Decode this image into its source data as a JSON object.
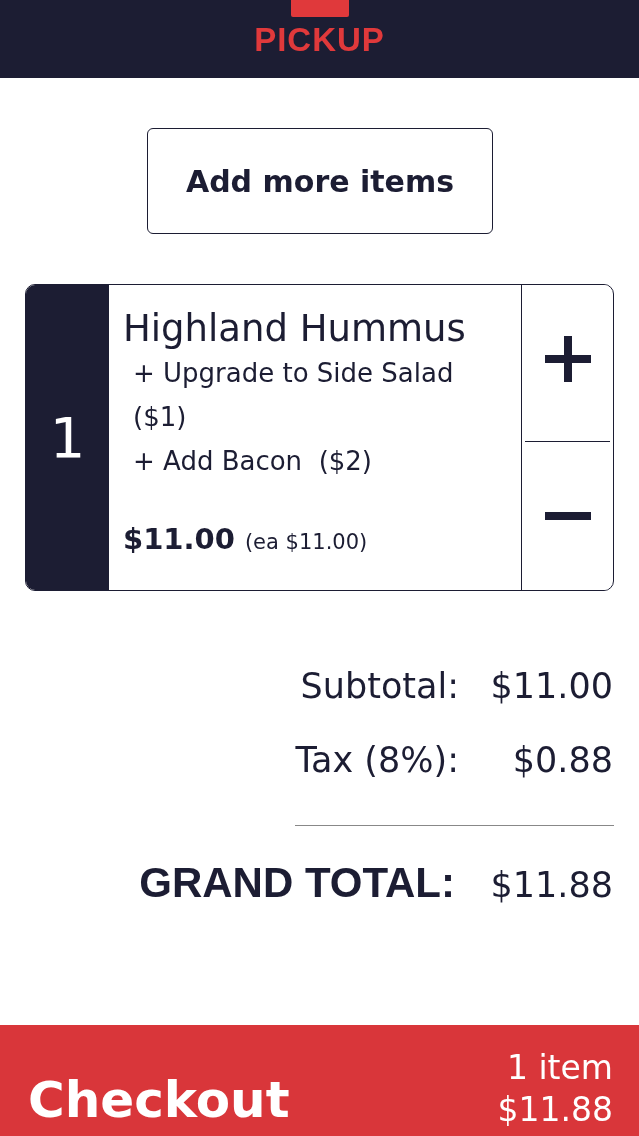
{
  "header": {
    "tab_label": "PICKUP"
  },
  "add_button": {
    "label": "Add more items"
  },
  "cart_items": [
    {
      "quantity": "1",
      "name": "Highland Hummus",
      "modifiers": [
        "+ Upgrade to Side Salad ($1)",
        "+ Add Bacon  ($2)"
      ],
      "price": "$11.00",
      "unit_price": "(ea $11.00)"
    }
  ],
  "totals": [
    {
      "kind": "line",
      "label": "Subtotal:",
      "value": "$11.00"
    },
    {
      "kind": "line",
      "label": "Tax (8%):",
      "value": "$0.88"
    },
    {
      "kind": "grand",
      "label": "GRAND TOTAL:",
      "value": "$11.88"
    }
  ],
  "checkout": {
    "label": "Checkout",
    "item_count": "1 item",
    "total": "$11.88"
  }
}
